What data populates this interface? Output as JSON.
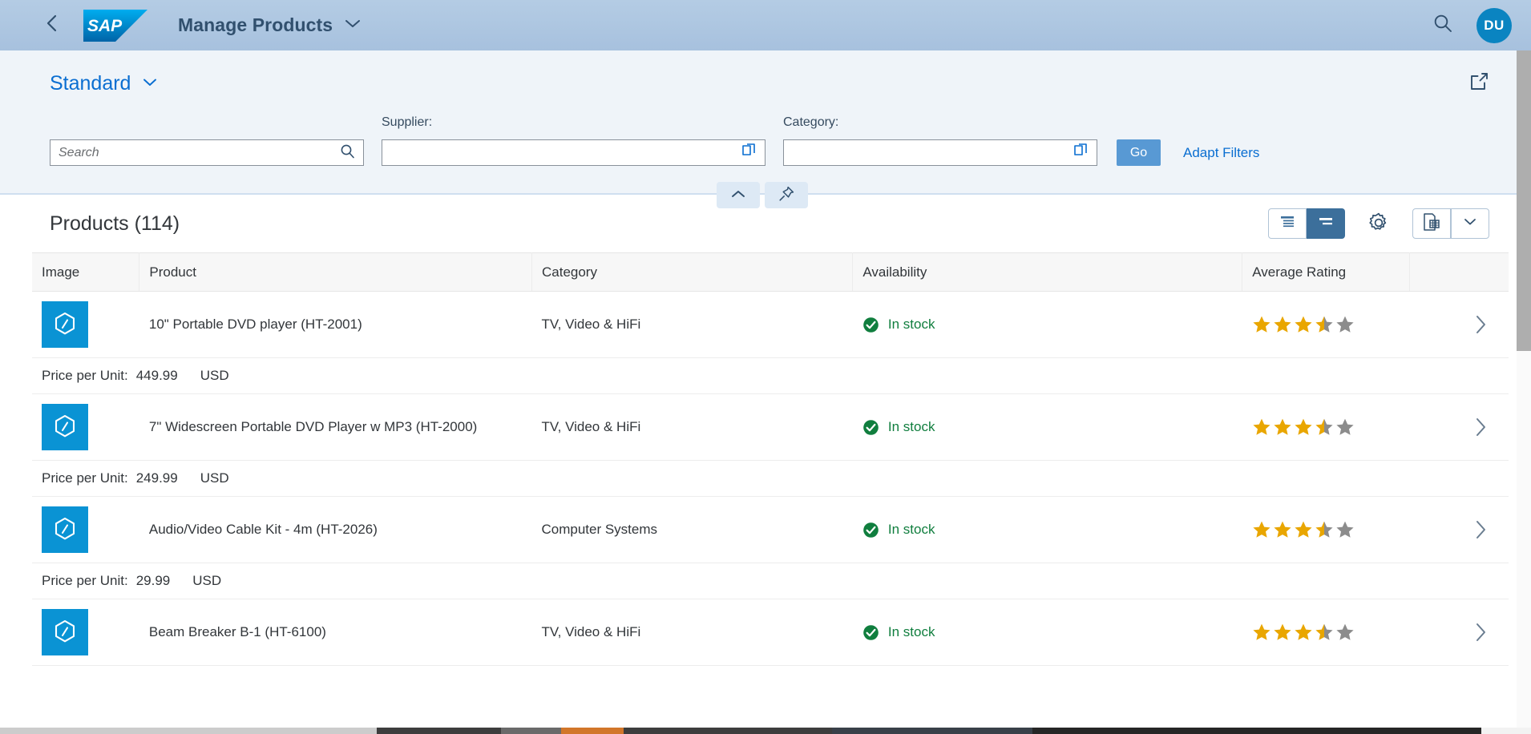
{
  "shell": {
    "back_icon": "back-chevron-icon",
    "logo_text": "SAP",
    "app_title": "Manage Products",
    "title_chevron": "chevron-down-icon",
    "search_icon": "search-icon",
    "avatar_initials": "DU"
  },
  "filterbar": {
    "variant_name": "Standard",
    "variant_chevron": "chevron-down-icon",
    "share_icon": "share-icon",
    "collapse_icon": "chevron-up-icon",
    "pin_icon": "pin-icon",
    "search": {
      "label": "",
      "placeholder": "Search",
      "value": "",
      "icon": "search-icon"
    },
    "supplier": {
      "label": "Supplier:",
      "value": "",
      "icon": "value-help-icon"
    },
    "category": {
      "label": "Category:",
      "value": "",
      "icon": "value-help-icon"
    },
    "go_label": "Go",
    "adapt_filters_label": "Adapt Filters"
  },
  "table": {
    "title": "Products (114)",
    "toolbar": {
      "density_compact_icon": "list-compact-icon",
      "density_cozy_icon": "list-cozy-icon",
      "settings_icon": "gear-icon",
      "export_icon": "export-to-spreadsheet-icon",
      "export_chevron_icon": "chevron-down-icon"
    },
    "columns": [
      "Image",
      "Product",
      "Category",
      "Availability",
      "Average Rating",
      ""
    ],
    "price_label": "Price per Unit:",
    "rows": [
      {
        "thumb_icon": "product-placeholder-icon",
        "product": "10\" Portable DVD player (HT-2001)",
        "category": "TV, Video & HiFi",
        "availability": "In stock",
        "availability_icon": "status-success-icon",
        "rating": 3.5,
        "price": "449.99",
        "currency": "USD",
        "nav_icon": "chevron-right-icon"
      },
      {
        "thumb_icon": "product-placeholder-icon",
        "product": "7\" Widescreen Portable DVD Player w MP3 (HT-2000)",
        "category": "TV, Video & HiFi",
        "availability": "In stock",
        "availability_icon": "status-success-icon",
        "rating": 3.5,
        "price": "249.99",
        "currency": "USD",
        "nav_icon": "chevron-right-icon"
      },
      {
        "thumb_icon": "product-placeholder-icon",
        "product": "Audio/Video Cable Kit - 4m (HT-2026)",
        "category": "Computer Systems",
        "availability": "In stock",
        "availability_icon": "status-success-icon",
        "rating": 3.5,
        "price": "29.99",
        "currency": "USD",
        "nav_icon": "chevron-right-icon"
      },
      {
        "thumb_icon": "product-placeholder-icon",
        "product": "Beam Breaker B-1 (HT-6100)",
        "category": "TV, Video & HiFi",
        "availability": "In stock",
        "availability_icon": "status-success-icon",
        "rating": 3.5,
        "price": "",
        "currency": "",
        "nav_icon": "chevron-right-icon"
      }
    ]
  },
  "colors": {
    "shell_bg": "#a7c1de",
    "brand_blue": "#0a6ed1",
    "accent_blue": "#0a93d4",
    "avatar_blue": "#0a84c1",
    "success_green": "#107e3e",
    "star_gold": "#e9a600",
    "star_gray": "#8c8c8c",
    "go_button": "#5899d4",
    "title_text": "#31506e"
  }
}
